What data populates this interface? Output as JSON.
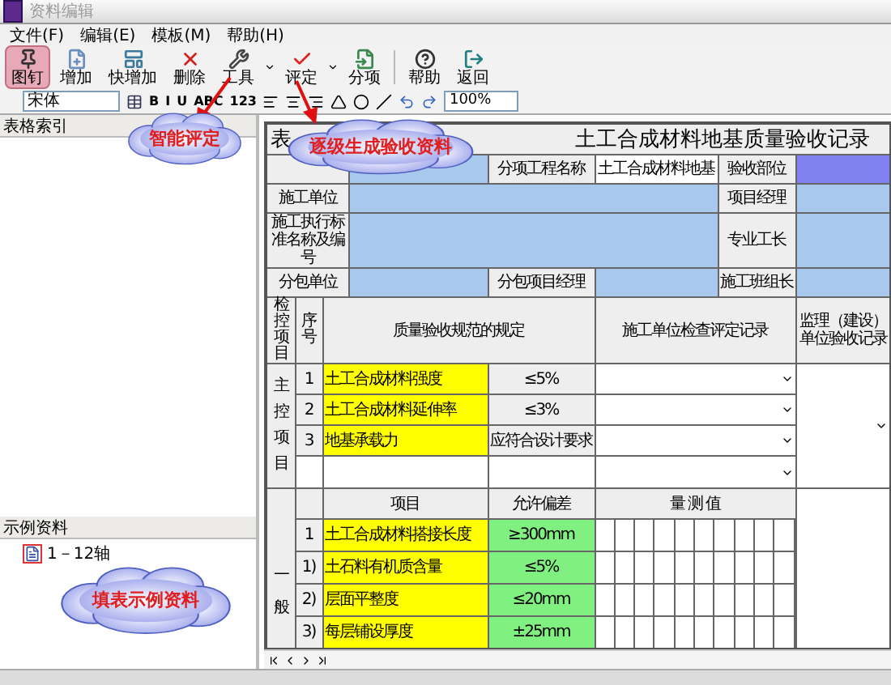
{
  "window": {
    "title": "资料编辑"
  },
  "menu": [
    "文件(F)",
    "编辑(E)",
    "模板(M)",
    "帮助(H)"
  ],
  "toolbar": {
    "buttons": [
      {
        "kind": "pin",
        "label": "图钉",
        "selected": true,
        "dropdown": false
      },
      {
        "kind": "add",
        "label": "增加",
        "selected": false,
        "dropdown": false
      },
      {
        "kind": "quick",
        "label": "快增加",
        "selected": false,
        "dropdown": false
      },
      {
        "kind": "delete",
        "label": "删除",
        "selected": false,
        "dropdown": false
      },
      {
        "kind": "tools",
        "label": "工具",
        "selected": false,
        "dropdown": true
      },
      {
        "kind": "check",
        "label": "评定",
        "selected": false,
        "dropdown": true
      },
      {
        "kind": "section",
        "label": "分项",
        "selected": false,
        "dropdown": false
      },
      {
        "kind": "help",
        "label": "帮助",
        "selected": false,
        "dropdown": false
      },
      {
        "kind": "exit",
        "label": "返回",
        "selected": false,
        "dropdown": false
      }
    ]
  },
  "format_bar": {
    "font": "宋体",
    "text_buttons": [
      "B",
      "I",
      "U",
      "ABC",
      "123"
    ],
    "zoom": "100%"
  },
  "left_panel": {
    "index_title": "表格索引",
    "examples_title": "示例资料",
    "examples": [
      {
        "label": "1－12轴"
      }
    ]
  },
  "callouts": [
    {
      "text": "智能评定"
    },
    {
      "text": "逐级生成验收资料"
    },
    {
      "text": "填表示例资料"
    }
  ],
  "document": {
    "prefix": "表",
    "title": "土工合成材料地基质量验收记录",
    "info": {
      "item_name_label": "分项工程名称",
      "item_name": "土工合成材料地基",
      "part_label": "验收部位",
      "contractor_label": "施工单位",
      "manager_label": "项目经理",
      "standard_label": "施工执行标准名称及编号",
      "foreman_label": "专业工长",
      "subcontractor_label": "分包单位",
      "sub_manager_label": "分包项目经理",
      "team_leader_label": "施工班组长"
    },
    "headers": {
      "category": "检控项目",
      "number": "序号",
      "spec": "质量验收规范的规定",
      "contractor_record": "施工单位检查评定记录",
      "supervisor_record": "监理（建设）单位验收记录"
    },
    "main_group": "主控项目",
    "main_items": [
      {
        "number": "1",
        "name": "土工合成材料强度",
        "value": "≤5%"
      },
      {
        "number": "2",
        "name": "土工合成材料延伸率",
        "value": "≤3%"
      },
      {
        "number": "3",
        "name": "地基承载力",
        "value": "应符合设计要求"
      }
    ],
    "general_group": "一般",
    "general_headers": {
      "item": "项目",
      "tolerance": "允许偏差",
      "measured": "量 测 值"
    },
    "general_items": [
      {
        "number": "1",
        "name": "土工合成材料搭接长度",
        "tolerance": "≥300mm"
      },
      {
        "number": "1)",
        "name": "土石料有机质含量",
        "tolerance": "≤5%"
      },
      {
        "number": "2)",
        "name": "层面平整度",
        "tolerance": "≤20mm"
      },
      {
        "number": "3)",
        "name": "每层铺设厚度",
        "tolerance": "±25mm"
      }
    ]
  }
}
